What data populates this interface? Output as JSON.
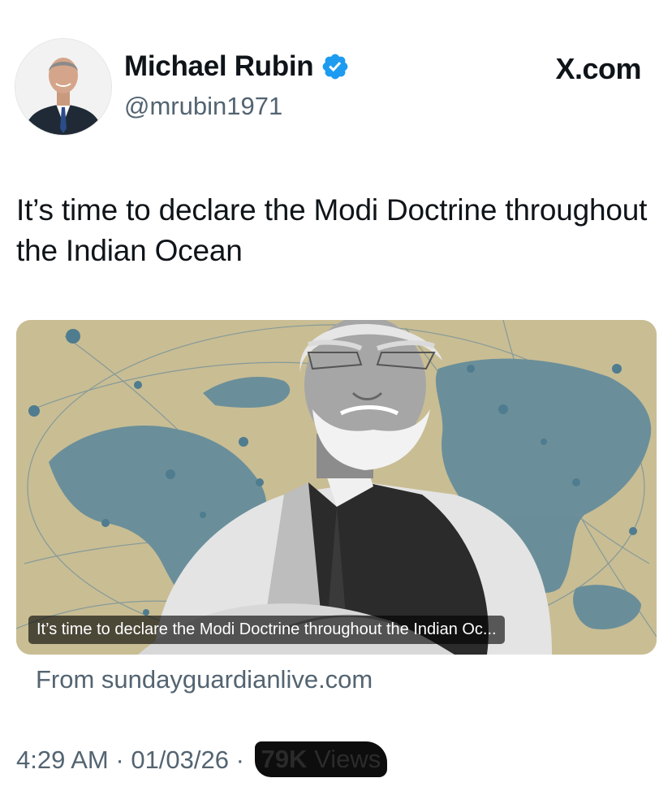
{
  "tweet": {
    "author": {
      "name": "Michael Rubin",
      "handle": "@mrubin1971",
      "verified": true,
      "avatar_icon": "profile-photo-man-in-suit"
    },
    "brand": "X.com",
    "text": "It’s time to declare the Modi Doctrine throughout the Indian Ocean",
    "link_card": {
      "image_icon": "illustration-man-arms-crossed-over-world-map-network",
      "caption": "It’s time to declare the Modi Doctrine throughout the Indian Oc...",
      "source": "From sundayguardianlive.com"
    },
    "meta": {
      "time": "4:29 AM",
      "separator": "·",
      "date": "01/03/26",
      "views_count": "79K",
      "views_label": "Views"
    }
  },
  "colors": {
    "text": "#0f1419",
    "secondary": "#536471",
    "verified_blue": "#1d9bf0",
    "map_background": "#c9bd94",
    "map_land": "#5f8a9a"
  }
}
